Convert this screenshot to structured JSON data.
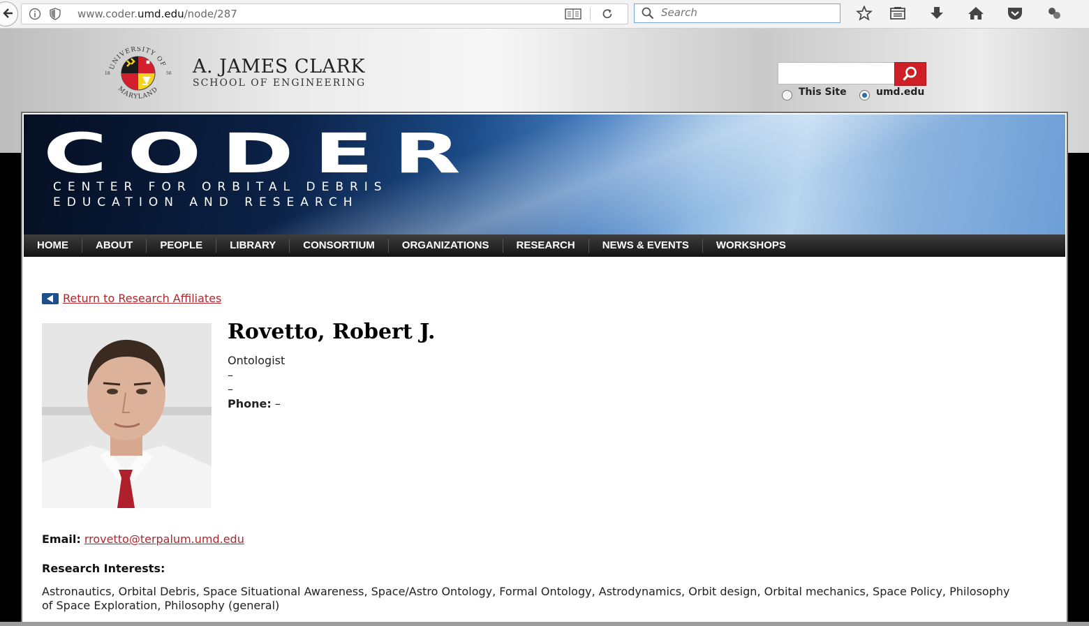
{
  "browser": {
    "url_prefix": "www.coder.",
    "url_domain": "umd.edu",
    "url_path": "/node/287",
    "search_placeholder": "Search"
  },
  "header": {
    "school_line1": "A. JAMES CLARK",
    "school_line2": "SCHOOL OF ENGINEERING",
    "logo_text": "UNIVERSITY OF MARYLAND",
    "logo_year_left": "18",
    "logo_year_right": "56",
    "radio_this_site": "This Site",
    "radio_umd": "umd.edu"
  },
  "banner": {
    "title": "CODER",
    "subtitle_line1": "CENTER FOR ORBITAL DEBRIS",
    "subtitle_line2": "EDUCATION AND RESEARCH"
  },
  "nav": {
    "items": [
      "HOME",
      "ABOUT",
      "PEOPLE",
      "LIBRARY",
      "CONSORTIUM",
      "ORGANIZATIONS",
      "RESEARCH",
      "NEWS & EVENTS",
      "WORKSHOPS"
    ]
  },
  "profile": {
    "return_link": "Return to Research Affiliates",
    "name": "Rovetto, Robert J.",
    "title": "Ontologist",
    "line2": "–",
    "line3": "–",
    "phone_label": "Phone:",
    "phone_value": " –",
    "email_label": "Email:",
    "email_value": "rrovetto@terpalum.umd.edu",
    "research_label": "Research Interests:",
    "research_text": "Astronautics, Orbital Debris, Space Situational Awareness, Space/Astro Ontology, Formal Ontology, Astrodynamics, Orbit design, Orbital mechanics, Space Policy, Philosophy of Space Exploration, Philosophy (general)"
  },
  "colors": {
    "accent_red": "#b0262c",
    "nav_bg": "#1e1e1e",
    "search_button": "#cf1f26"
  }
}
